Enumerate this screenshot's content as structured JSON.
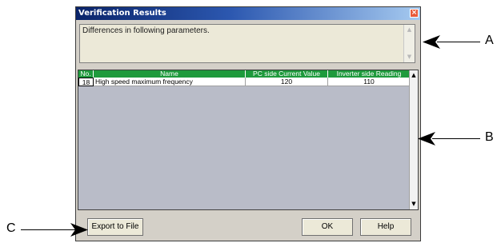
{
  "dialog": {
    "title": "Verification Results",
    "close_glyph": "×",
    "message": "Differences in following parameters."
  },
  "table": {
    "columns": [
      "No.",
      "Name",
      "PC side Current Value",
      "Inverter side Reading"
    ],
    "rows": [
      {
        "no": "18",
        "name": "High speed maximum frequency",
        "pc_value": "120",
        "inverter_value": "110"
      }
    ]
  },
  "buttons": {
    "export": "Export to File",
    "ok": "OK",
    "help": "Help"
  },
  "callouts": {
    "a": "A",
    "b": "B",
    "c": "C"
  },
  "colors": {
    "title_bar": "#0a246a",
    "header_green": "#1e9a3c",
    "grid_background": "#b9bcc8"
  }
}
